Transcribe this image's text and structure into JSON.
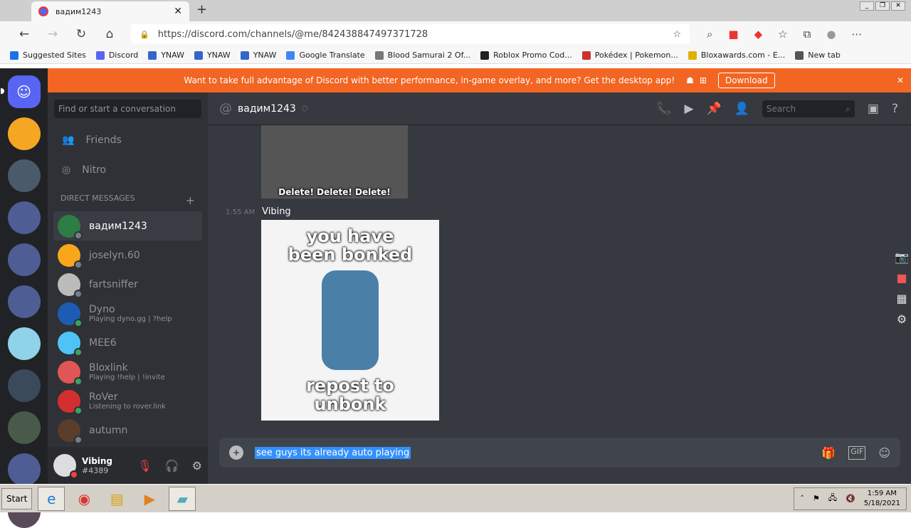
{
  "browser": {
    "tab_title": "вадим1243",
    "url": "https://discord.com/channels/@me/842438847497371728",
    "bookmarks": [
      "Suggested Sites",
      "Discord",
      "YNAW",
      "YNAW",
      "YNAW",
      "Google Translate",
      "Blood Samurai 2 Of...",
      "Roblox Promo Cod...",
      "Pokédex | Pokemon...",
      "Bloxawards.com - E...",
      "New tab"
    ]
  },
  "banner": {
    "text": "Want to take full advantage of Discord with better performance, in-game overlay, and more? Get the desktop app!",
    "download": "Download"
  },
  "sidebar": {
    "search_placeholder": "Find or start a conversation",
    "friends": "Friends",
    "nitro": "Nitro",
    "dm_header": "DIRECT MESSAGES",
    "dms": [
      {
        "name": "вадим1243",
        "sub": "",
        "color": "#2d7d46",
        "status": "offline"
      },
      {
        "name": "joselyn.60",
        "sub": "",
        "color": "#faa61a",
        "status": "offline"
      },
      {
        "name": "fartsniffer",
        "sub": "",
        "color": "#bbb",
        "status": "offline"
      },
      {
        "name": "Dyno",
        "sub": "Playing dyno.gg | ?help",
        "color": "#1e5cb3",
        "status": "online"
      },
      {
        "name": "MEE6",
        "sub": "",
        "color": "#4fc3f7",
        "status": "online"
      },
      {
        "name": "Bloxlink",
        "sub": "Playing !help | !invite",
        "color": "#e05555",
        "status": "online"
      },
      {
        "name": "RoVer",
        "sub": "Listening to rover.link",
        "color": "#d32f2f",
        "status": "online"
      },
      {
        "name": "autumn",
        "sub": "",
        "color": "#5a3d2b",
        "status": "offline"
      }
    ]
  },
  "user": {
    "name": "Vibing",
    "tag": "#4389"
  },
  "channel": {
    "name": "вадим1243",
    "search_placeholder": "Search"
  },
  "messages": [
    {
      "image_caption": "Delete! Delete! Delete!"
    },
    {
      "time": "1:55 AM",
      "author": "Vibing",
      "image_top": "you have been bonked",
      "image_bottom": "repost to unbonk"
    }
  ],
  "composer": {
    "value": "see guys its already auto playing",
    "gif": "GIF"
  },
  "taskbar": {
    "start": "Start",
    "time": "1:59 AM",
    "date": "5/18/2021"
  }
}
